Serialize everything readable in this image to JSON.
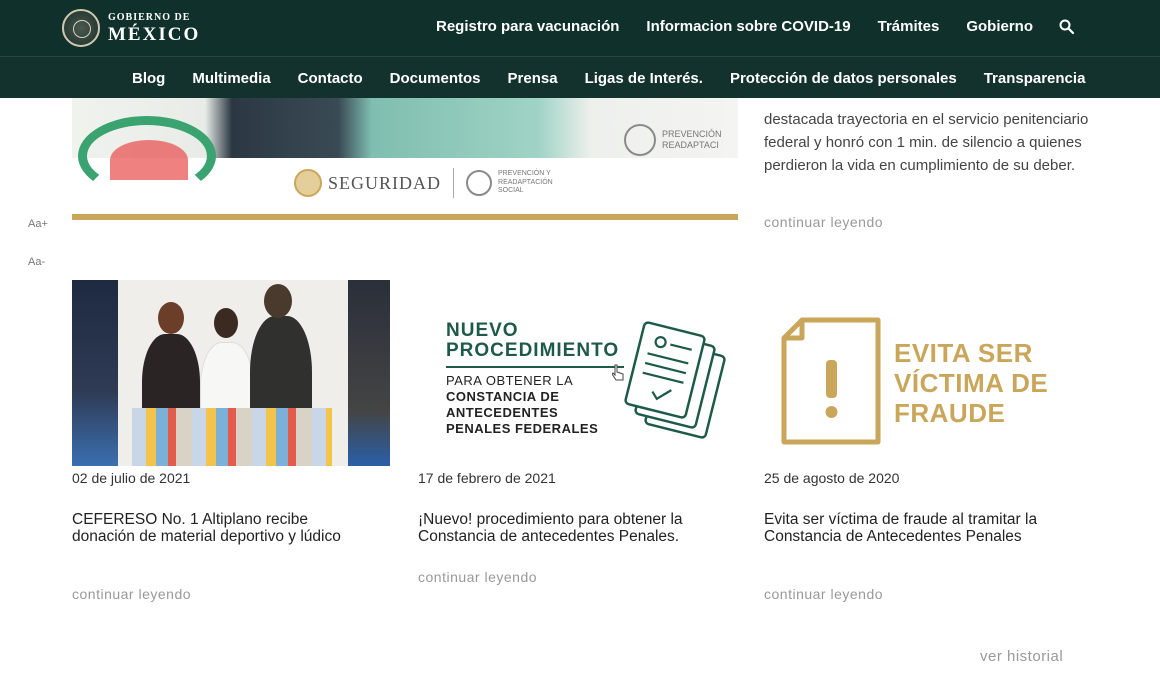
{
  "header": {
    "logo_small": "GOBIERNO DE",
    "logo_big": "MÉXICO",
    "nav": [
      "Registro para vacunación",
      "Informacion sobre COVID-19",
      "Trámites",
      "Gobierno"
    ],
    "search_icon": "search-icon"
  },
  "subnav": [
    "Blog",
    "Multimedia",
    "Contacto",
    "Documentos",
    "Prensa",
    "Ligas de Interés.",
    "Protección de datos personales",
    "Transparencia"
  ],
  "font_controls": {
    "increase": "Aa+",
    "decrease": "Aa-"
  },
  "banner": {
    "seguridad": "SEGURIDAD",
    "prevencion_small": "PREVENCIÓN Y READAPTACIÓN SOCIAL",
    "prevencion_right": "PREVENCIÓN READAPTACI"
  },
  "featured": {
    "text": "destacada trayectoria en el servicio penitenciario federal y honró con 1 min. de silencio a quienes perdieron la vida en cumplimiento de su deber.",
    "more": "continuar leyendo"
  },
  "cards": [
    {
      "date": "02 de julio de 2021",
      "title": "CEFERESO No. 1 Altiplano recibe donación de material deportivo y lúdico",
      "more": "continuar leyendo"
    },
    {
      "date": "17 de febrero de 2021",
      "title": "¡Nuevo! procedimiento para obtener la Constancia de antecedentes Penales.",
      "more": "continuar leyendo",
      "graphic": {
        "line1": "NUEVO",
        "line2": "PROCEDIMIENTO",
        "sub1": "PARA OBTENER LA",
        "sub2": "CONSTANCIA DE",
        "sub3": "ANTECEDENTES",
        "sub4": "PENALES FEDERALES"
      }
    },
    {
      "date": "25 de agosto de 2020",
      "title": "Evita ser víctima de fraude al tramitar la Constancia de Antecedentes Penales",
      "more": "continuar leyendo",
      "graphic": {
        "line1": "EVITA SER",
        "line2": "VÍCTIMA DE",
        "line3": "FRAUDE"
      }
    }
  ],
  "footer": {
    "history": "ver historial"
  },
  "colors": {
    "header": "#10312b",
    "gold": "#c9a65a",
    "green": "#1d5a48"
  }
}
